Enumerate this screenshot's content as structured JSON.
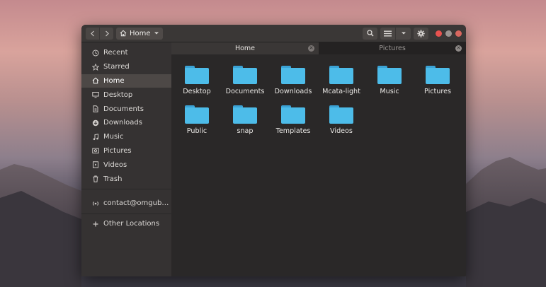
{
  "header": {
    "back_icon": "chevron-left-icon",
    "forward_icon": "chevron-right-icon",
    "location_label": "Home",
    "location_icon": "home-icon",
    "search_icon": "search-icon",
    "view_icon": "list-view-icon",
    "view_menu_icon": "chevron-down-icon",
    "menu_icon": "gear-icon"
  },
  "sidebar": {
    "items": [
      {
        "label": "Recent",
        "icon": "clock-icon"
      },
      {
        "label": "Starred",
        "icon": "star-icon"
      },
      {
        "label": "Home",
        "icon": "home-icon",
        "active": true
      },
      {
        "label": "Desktop",
        "icon": "desktop-icon"
      },
      {
        "label": "Documents",
        "icon": "documents-icon"
      },
      {
        "label": "Downloads",
        "icon": "download-icon"
      },
      {
        "label": "Music",
        "icon": "music-icon"
      },
      {
        "label": "Pictures",
        "icon": "pictures-icon"
      },
      {
        "label": "Videos",
        "icon": "videos-icon"
      },
      {
        "label": "Trash",
        "icon": "trash-icon"
      }
    ],
    "account": {
      "label": "contact@omgub…",
      "icon": "network-icon"
    },
    "other": {
      "label": "Other Locations",
      "icon": "plus-icon"
    }
  },
  "tabs": [
    {
      "label": "Home",
      "active": true
    },
    {
      "label": "Pictures",
      "active": false
    }
  ],
  "files": [
    {
      "name": "Desktop"
    },
    {
      "name": "Documents"
    },
    {
      "name": "Downloads"
    },
    {
      "name": "Mcata-light"
    },
    {
      "name": "Music"
    },
    {
      "name": "Pictures"
    },
    {
      "name": "Public"
    },
    {
      "name": "snap"
    },
    {
      "name": "Templates"
    },
    {
      "name": "Videos"
    }
  ],
  "colors": {
    "folder": "#4dbce9",
    "folder_tab": "#3ba3d6",
    "close_button": "#e8524f",
    "sidebar_bg": "#353232",
    "window_bg": "#2b2a2a"
  }
}
